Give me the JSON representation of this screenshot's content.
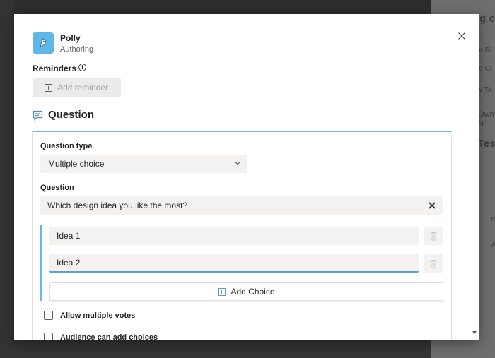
{
  "app": {
    "name": "Polly",
    "subtitle": "Authoring"
  },
  "reminders": {
    "label": "Reminders",
    "info_icon": "info-icon",
    "add_button": "Add reminder"
  },
  "question_section": {
    "title": "Question",
    "icon": "chat-icon",
    "type_label": "Question type",
    "type_value": "Multiple choice",
    "question_label": "Question",
    "question_value": "Which design idea you like the most?",
    "choices": [
      {
        "value": "Idea 1"
      },
      {
        "value": "Idea 2"
      }
    ],
    "add_choice": "Add Choice",
    "options": [
      {
        "label": "Allow multiple votes",
        "checked": false
      },
      {
        "label": "Audience can add choices",
        "checked": false
      }
    ]
  },
  "background": {
    "fragments": [
      "g cl",
      "ar Ri",
      "ro Cl",
      "ry  Ta",
      "Own",
      "N",
      "Tes",
      "S",
      "A"
    ]
  },
  "colors": {
    "accent": "#6cb2eb",
    "app_icon_bg": "#5fb7e8"
  }
}
